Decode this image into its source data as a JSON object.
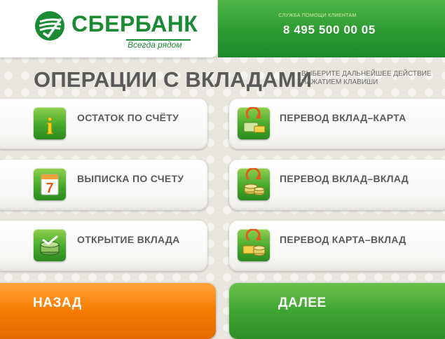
{
  "brand": {
    "name": "СБЕРБАНК",
    "slogan": "Всегда рядом"
  },
  "help": {
    "label": "СЛУЖБА ПОМОЩИ КЛИЕНТАМ",
    "phone": "8 495 500 00 05"
  },
  "title": "ОПЕРАЦИИ С ВКЛАДАМИ",
  "hint": "ВЫБЕРИТЕ ДАЛЬНЕЙШЕЕ ДЕЙСТВИЕ НАЖАТИЕМ КЛАВИШИ",
  "options": [
    {
      "label": "ОСТАТОК ПО СЧЁТУ",
      "icon": "info-icon"
    },
    {
      "label": "ПЕРЕВОД ВКЛАД–КАРТА",
      "icon": "transfer-deposit-card-icon"
    },
    {
      "label": "ВЫПИСКА ПО СЧЕТУ",
      "icon": "statement-icon"
    },
    {
      "label": "ПЕРЕВОД ВКЛАД–ВКЛАД",
      "icon": "transfer-deposit-deposit-icon"
    },
    {
      "label": "ОТКРЫТИЕ ВКЛАДА",
      "icon": "open-deposit-icon"
    },
    {
      "label": "ПЕРЕВОД КАРТА–ВКЛАД",
      "icon": "transfer-card-deposit-icon"
    }
  ],
  "nav": {
    "back": "НАЗАД",
    "next": "ДАЛЕЕ"
  },
  "colors": {
    "brand_green": "#1a8a33",
    "back_orange": "#f57c00",
    "next_green": "#3fa532",
    "text_gray": "#5a5a5a"
  }
}
